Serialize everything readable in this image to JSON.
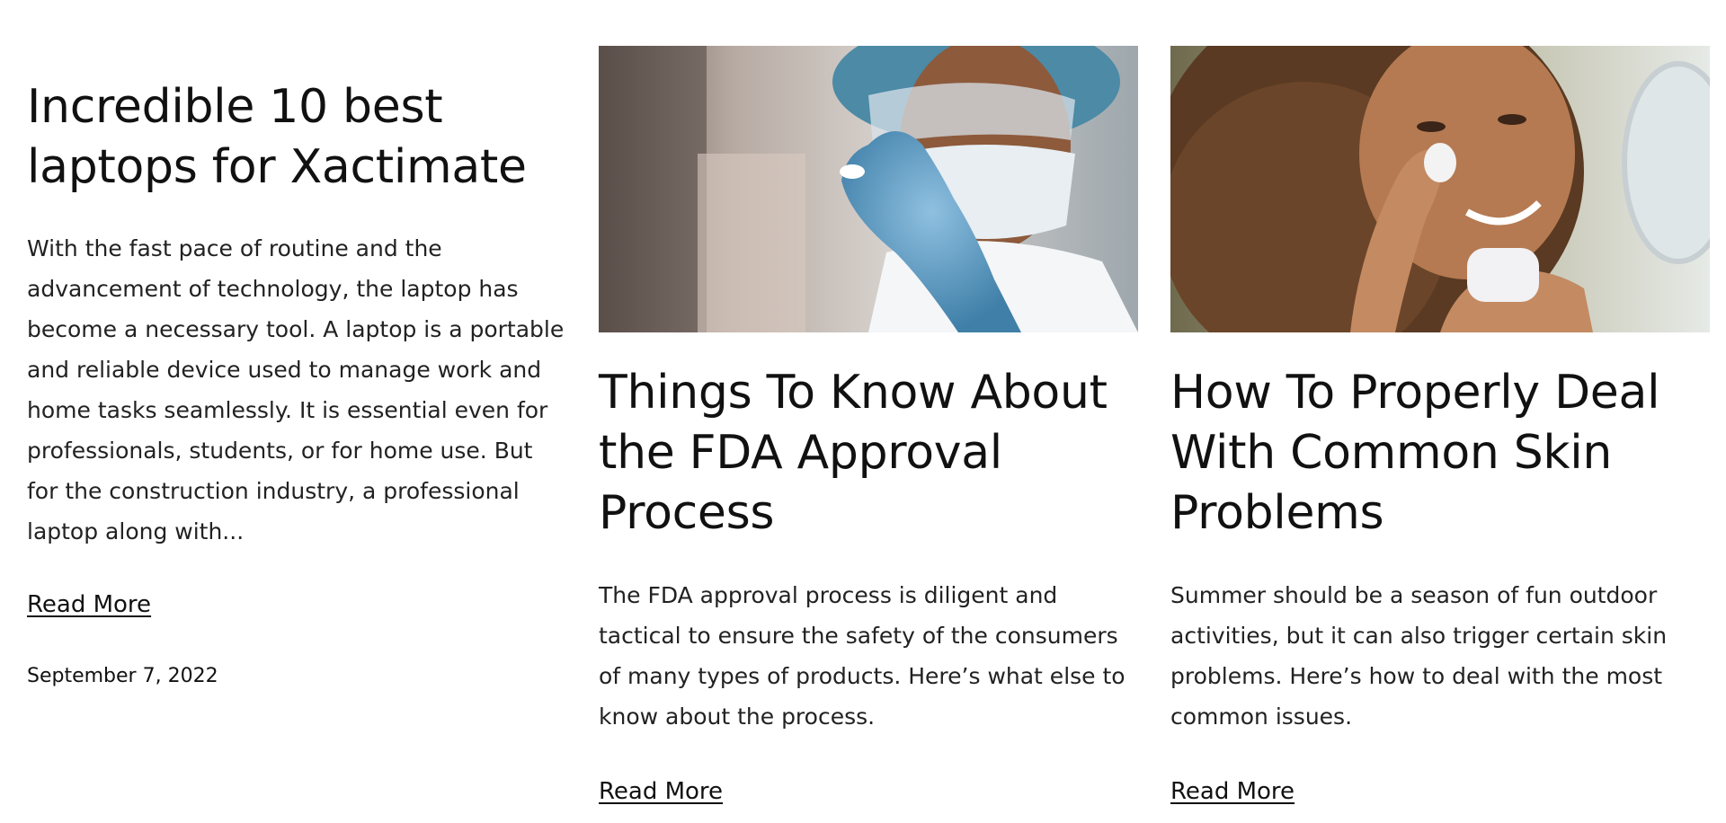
{
  "posts": [
    {
      "title": "Incredible 10 best laptops for Xactimate",
      "excerpt": "With the fast pace of routine and the advancement of technology, the laptop has become a necessary tool. A laptop is a portable and reliable device used to manage work and home tasks seamlessly. It is essential even for professionals, students, or for home use. But for the construction industry, a professional laptop along with...",
      "read_more": "Read More",
      "date": "September 7, 2022"
    },
    {
      "title": "Things To Know About the FDA Approval Process",
      "excerpt": "The FDA approval process is diligent and tactical to ensure the safety of the consumers of many types of products. Here’s what else to know about the process.",
      "read_more": "Read More"
    },
    {
      "title": "How To Properly Deal With Common Skin Problems",
      "excerpt": "Summer should be a season of fun outdoor activities, but it can also trigger certain skin problems. Here’s how to deal with the most common issues.",
      "read_more": "Read More"
    }
  ]
}
